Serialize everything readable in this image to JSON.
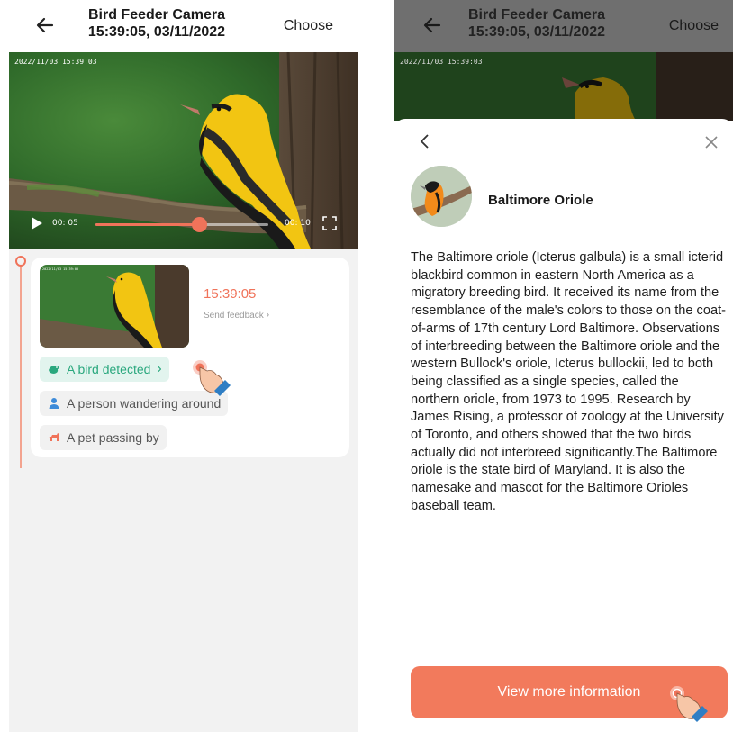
{
  "left": {
    "header": {
      "title": "Bird Feeder Camera",
      "subtitle": "15:39:05, 03/11/2022",
      "choose_label": "Choose",
      "back_icon": "arrow-left-icon"
    },
    "video": {
      "timestamp": "2022/11/03 15:39:03",
      "current_time": "00: 05",
      "end_time": "00: 10",
      "progress": 0.6
    },
    "event": {
      "time": "15:39:05",
      "feedback_label": "Send feedback",
      "tags": [
        {
          "label": "A bird detected",
          "icon": "bird-icon",
          "active": true
        },
        {
          "label": "A person wandering around",
          "icon": "person-icon"
        },
        {
          "label": "A pet passing by",
          "icon": "pet-icon"
        }
      ]
    }
  },
  "right": {
    "header": {
      "title": "Bird Feeder Camera",
      "subtitle": "15:39:05, 03/11/2022",
      "choose_label": "Choose"
    },
    "video": {
      "timestamp": "2022/11/03 15:39:03"
    },
    "sheet": {
      "bird_name": "Baltimore Oriole",
      "description": "The Baltimore oriole (Icterus galbula) is a small icterid blackbird common in eastern North America as a migratory breeding bird. It received its name from the resemblance of the male's colors to those on the coat-of-arms of 17th century Lord Baltimore. Observations of interbreeding between the Baltimore oriole and the western Bullock's oriole, Icterus bullockii, led to both being classified as a single species, called the northern oriole, from 1973 to 1995. Research by James Rising, a professor of zoology at the University of Toronto, and others showed that the two birds actually did not interbreed significantly.The Baltimore oriole is the state bird of Maryland. It is also the namesake and mascot for the Baltimore Orioles baseball team.",
      "button_label": "View more information"
    }
  },
  "colors": {
    "accent": "#f0735a",
    "bird_tag_bg": "#e2f4ee",
    "bird_tag_text": "#2aa87e",
    "button": "#f27a5c"
  }
}
